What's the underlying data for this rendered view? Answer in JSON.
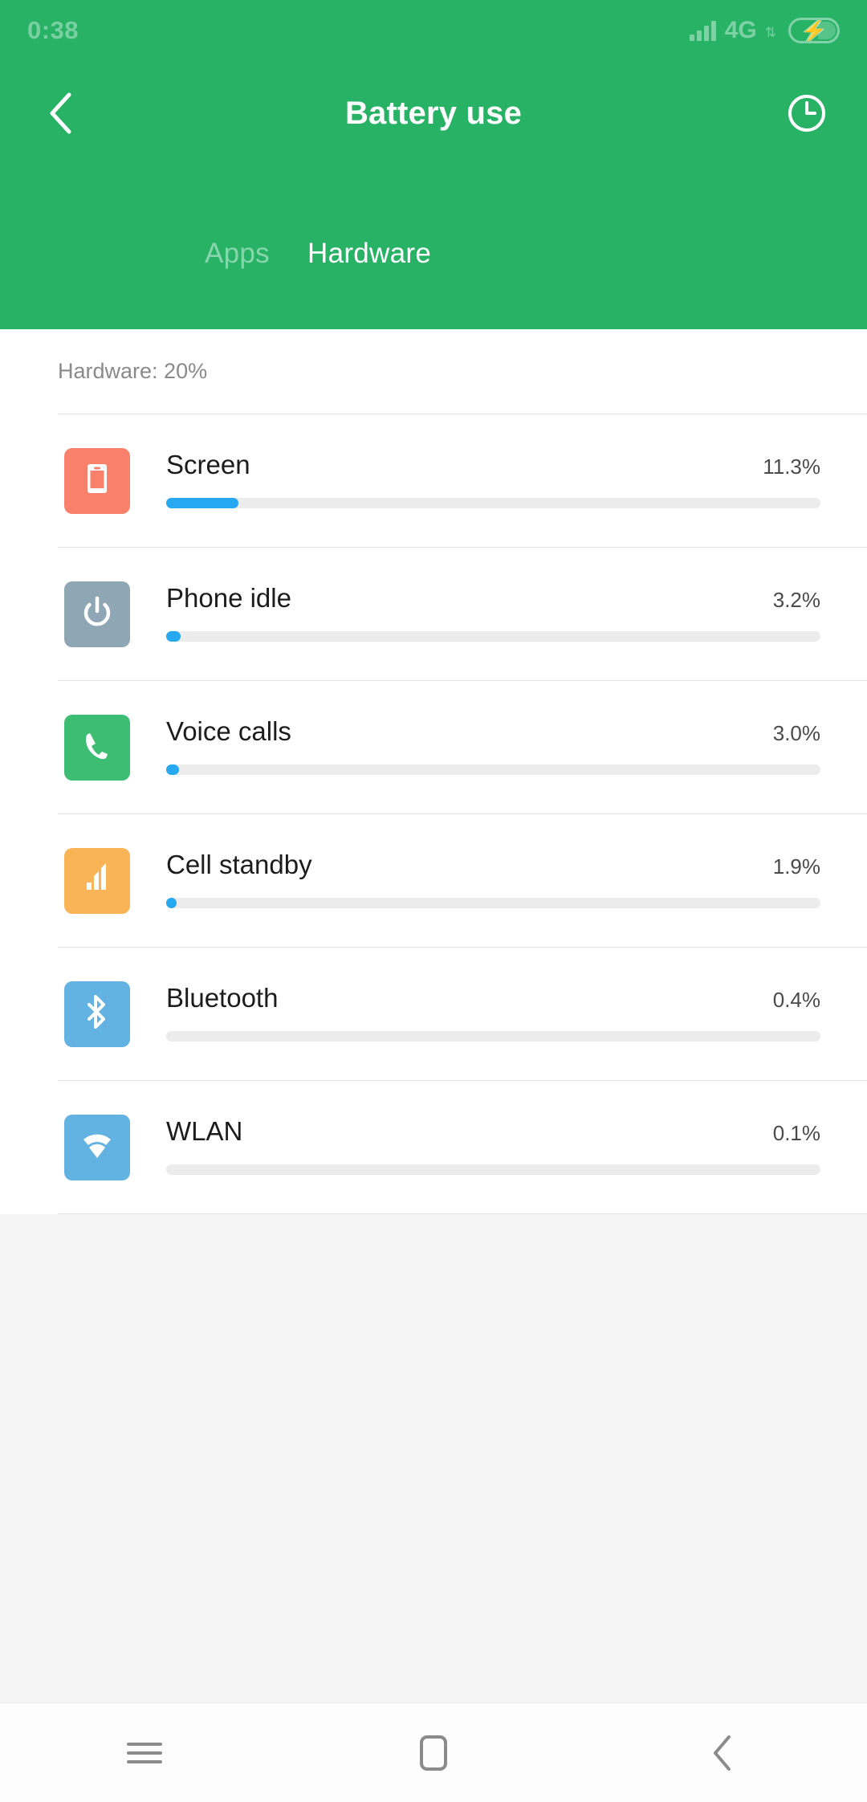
{
  "statusbar": {
    "clock": "0:38",
    "network_label": "4G",
    "network_arrows": "⇅",
    "signal_icon": "signal-bars-icon",
    "battery_icon": "battery-charging-icon",
    "tint": "#ffffff"
  },
  "header": {
    "title": "Battery use",
    "back_icon": "chevron-left-icon",
    "history_icon": "clock-icon",
    "background": "#27b266",
    "tabs": [
      {
        "label": "Apps",
        "active": false
      },
      {
        "label": "Hardware",
        "active": true
      }
    ]
  },
  "list": {
    "section_label": "Hardware: 20%",
    "bar_color": "#26a9f0",
    "track_color": "#ececec",
    "rows": [
      {
        "name": "Screen",
        "percent": "11.3%",
        "fill": 11.0,
        "icon": "screen-icon",
        "tile_color": "#f9806a"
      },
      {
        "name": "Phone idle",
        "percent": "3.2%",
        "fill": 2.2,
        "icon": "power-icon",
        "tile_color": "#8fa7b5"
      },
      {
        "name": "Voice calls",
        "percent": "3.0%",
        "fill": 2.0,
        "icon": "phone-icon",
        "tile_color": "#3dbd74"
      },
      {
        "name": "Cell standby",
        "percent": "1.9%",
        "fill": 1.6,
        "icon": "cell-signal-icon",
        "tile_color": "#f8b košer"
      },
      {
        "name": "Bluetooth",
        "percent": "0.4%",
        "fill": 0.0,
        "icon": "bluetooth-icon",
        "tile_color": "#62b3e2"
      },
      {
        "name": "WLAN",
        "percent": "0.1%",
        "fill": 0.0,
        "icon": "wifi-icon",
        "tile_color": "#62b3e2"
      }
    ]
  },
  "navbar": {
    "menu_icon": "menu-icon",
    "home_icon": "home-icon",
    "back_icon": "back-chevron-icon"
  }
}
